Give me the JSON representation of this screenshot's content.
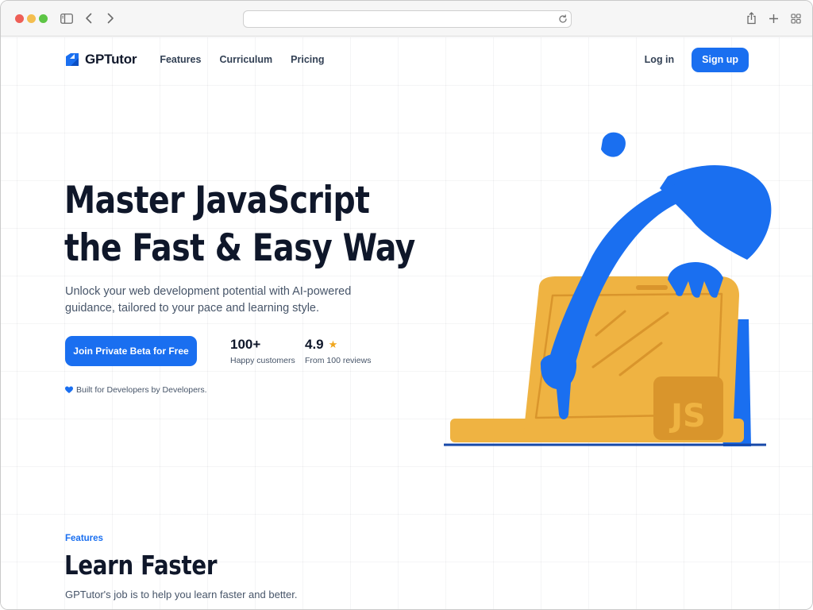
{
  "browser": {
    "address_value": ""
  },
  "nav": {
    "brand": "GPTutor",
    "links": [
      "Features",
      "Curriculum",
      "Pricing"
    ],
    "login": "Log in",
    "signup": "Sign up"
  },
  "hero": {
    "title_line1": "Master JavaScript",
    "title_line2": "the Fast & Easy Way",
    "subtitle": "Unlock your web development potential with AI-powered guidance, tailored to your pace and learning style.",
    "cta": "Join Private Beta for Free",
    "stats": [
      {
        "value": "100+",
        "label": "Happy customers"
      },
      {
        "value": "4.9",
        "label": "From 100 reviews",
        "icon": "star-icon"
      }
    ],
    "built_for": "Built for Developers by Developers.",
    "illustration_badge": "JS"
  },
  "features": {
    "eyebrow": "Features",
    "title": "Learn Faster",
    "subtitle": "GPTutor's job is to help you learn faster and better."
  },
  "colors": {
    "primary": "#1a6ff0",
    "heading": "#0f172a",
    "body": "#475569",
    "laptop": "#efb342",
    "star": "#f0a61c"
  }
}
